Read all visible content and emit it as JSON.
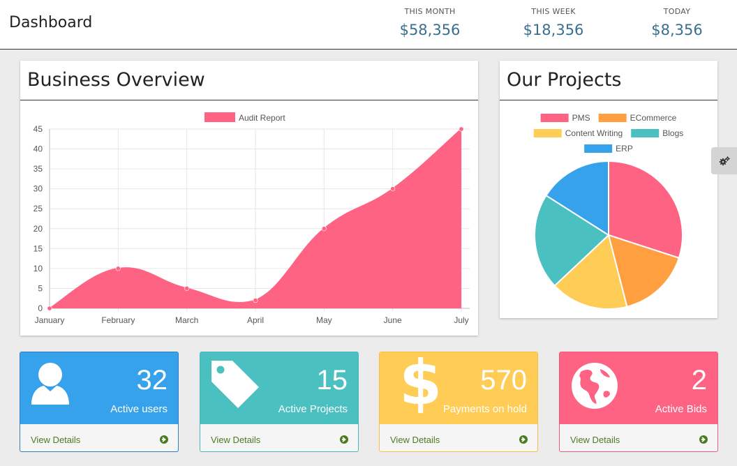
{
  "header": {
    "title": "Dashboard",
    "stats": [
      {
        "label": "THIS MONTH",
        "value": "$58,356"
      },
      {
        "label": "THIS WEEK",
        "value": "$18,356"
      },
      {
        "label": "TODAY",
        "value": "$8,356"
      }
    ]
  },
  "overview": {
    "title": "Business Overview"
  },
  "projects": {
    "title": "Our Projects"
  },
  "chart_data": [
    {
      "type": "area",
      "categories": [
        "January",
        "February",
        "March",
        "April",
        "May",
        "June",
        "July"
      ],
      "series": [
        {
          "name": "Audit Report",
          "values": [
            0,
            10,
            5,
            2,
            20,
            30,
            45
          ],
          "color": "#ff6384"
        }
      ],
      "ylim": [
        0,
        45
      ],
      "yticks": [
        0,
        5,
        10,
        15,
        20,
        25,
        30,
        35,
        40,
        45
      ],
      "grid": true,
      "legend": "top-center"
    },
    {
      "type": "pie",
      "slices": [
        {
          "name": "PMS",
          "value": 30,
          "color": "#ff6384"
        },
        {
          "name": "ECommerce",
          "value": 16,
          "color": "#ff9f40"
        },
        {
          "name": "Content Writing",
          "value": 17,
          "color": "#ffcd56"
        },
        {
          "name": "Blogs",
          "value": 21,
          "color": "#4bc0c0"
        },
        {
          "name": "ERP",
          "value": 16,
          "color": "#36a2eb"
        }
      ],
      "legend": "top"
    }
  ],
  "cards": [
    {
      "number": "32",
      "caption": "Active users",
      "link": "View Details",
      "icon": "user-icon",
      "color": "#36a2eb",
      "border": "#2f7fc0"
    },
    {
      "number": "15",
      "caption": "Active Projects",
      "link": "View Details",
      "icon": "tag-icon",
      "color": "#4bc0c0",
      "border": "#4bb5b5"
    },
    {
      "number": "570",
      "caption": "Payments on hold",
      "link": "View Details",
      "icon": "dollar-icon",
      "color": "#ffcd56",
      "border": "#f5c04a"
    },
    {
      "number": "2",
      "caption": "Active Bids",
      "link": "View Details",
      "icon": "globe-icon",
      "color": "#ff6384",
      "border": "#f05a78"
    }
  ],
  "settings": {
    "icon": "gears-icon"
  }
}
